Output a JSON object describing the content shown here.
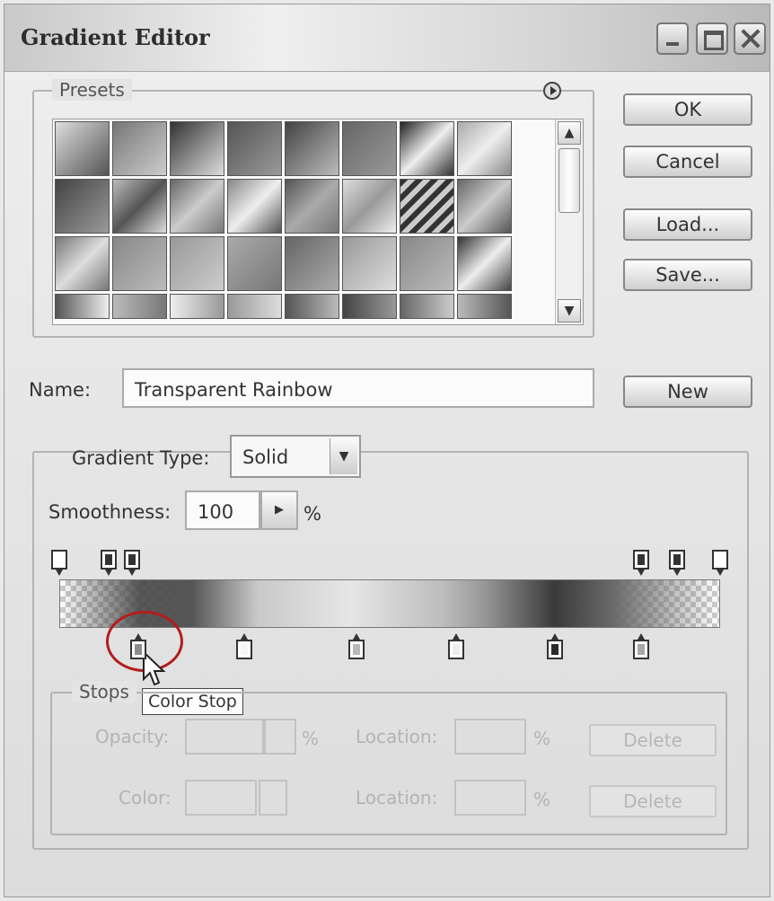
{
  "window": {
    "title": "Gradient Editor"
  },
  "presets": {
    "label": "Presets",
    "swatches": [
      "linear-gradient(135deg,#ddd,#555)",
      "linear-gradient(135deg,#777,#ccc)",
      "linear-gradient(135deg,#333,#ddd)",
      "linear-gradient(135deg,#555,#999)",
      "linear-gradient(135deg,#444,#bbb)",
      "linear-gradient(135deg,#666,#999)",
      "linear-gradient(135deg,#222,#eee,#333)",
      "linear-gradient(135deg,#aaa,#eee,#888)",
      "linear-gradient(135deg,#444,#999)",
      "linear-gradient(135deg,#bbb,#555,#ddd)",
      "linear-gradient(135deg,#666,#ccc,#777)",
      "linear-gradient(135deg,#888,#eee,#555)",
      "linear-gradient(135deg,#555,#aaa,#777)",
      "linear-gradient(135deg,#ddd,#999,#eee)",
      "repeating-linear-gradient(135deg,#333 0 6px,#ccc 6px 12px)",
      "linear-gradient(135deg,#666,#ccc,#555)",
      "linear-gradient(135deg,#777,#ddd,#777)",
      "linear-gradient(135deg,#888,#bbb)",
      "linear-gradient(135deg,#999,#ccc)",
      "linear-gradient(135deg,#aaa,#777)",
      "linear-gradient(135deg,#666,#aaa)",
      "linear-gradient(135deg,#999,#ddd)",
      "linear-gradient(135deg,#888,#bbb)",
      "linear-gradient(135deg,#333,#eee,#444)",
      "linear-gradient(90deg,#555,#eee)",
      "linear-gradient(90deg,#bbb,#777)",
      "linear-gradient(90deg,#eee,#999)",
      "linear-gradient(90deg,#999,#ddd)",
      "linear-gradient(90deg,#555,#bbb)",
      "linear-gradient(90deg,#444,#999)",
      "linear-gradient(90deg,#666,#ccc)",
      "linear-gradient(90deg,#bbb,#555)"
    ]
  },
  "buttons": {
    "ok": "OK",
    "cancel": "Cancel",
    "load": "Load...",
    "save": "Save...",
    "new": "New"
  },
  "name": {
    "label": "Name:",
    "value": "Transparent Rainbow"
  },
  "gradient": {
    "type_label": "Gradient Type:",
    "type_value": "Solid",
    "smoothness_label": "Smoothness:",
    "smoothness_value": "100",
    "smoothness_unit": "%",
    "opacity_stops": [
      {
        "pos": 0.0,
        "fill": "#ffffff"
      },
      {
        "pos": 0.075,
        "fill": "#333333"
      },
      {
        "pos": 0.11,
        "fill": "#333333"
      },
      {
        "pos": 0.88,
        "fill": "#333333"
      },
      {
        "pos": 0.935,
        "fill": "#333333"
      },
      {
        "pos": 1.0,
        "fill": "#ffffff"
      }
    ],
    "color_stops": [
      {
        "pos": 0.12,
        "fill": "#8c8c8c"
      },
      {
        "pos": 0.28,
        "fill": "#f6f6f6"
      },
      {
        "pos": 0.45,
        "fill": "#b8b8b8"
      },
      {
        "pos": 0.6,
        "fill": "#ececec"
      },
      {
        "pos": 0.75,
        "fill": "#2b2b2b"
      },
      {
        "pos": 0.88,
        "fill": "#a8a8a8"
      }
    ]
  },
  "tooltip": {
    "text": "Color Stop"
  },
  "stops": {
    "label": "Stops",
    "opacity_label": "Opacity:",
    "opacity_unit": "%",
    "color_label": "Color:",
    "location_label": "Location:",
    "location_unit": "%",
    "delete_label": "Delete"
  }
}
